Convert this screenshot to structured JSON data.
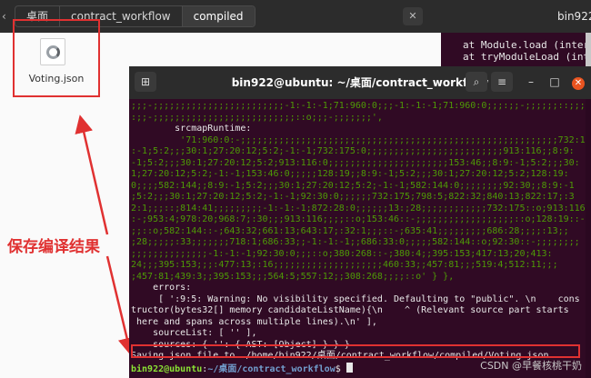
{
  "file_manager": {
    "breadcrumbs": [
      "桌面",
      "contract_workflow",
      "compiled"
    ],
    "file_name": "Voting.json"
  },
  "annotation_text": "保存编译结果",
  "terminal2": {
    "title": "bin922@",
    "lines": [
      "at Module.load (interna",
      "at tryModuleLoad (inte"
    ]
  },
  "terminal": {
    "title": "bin922@ubuntu: ~/桌面/contract_workflow",
    "lines": [
      {
        "style": "gr",
        "text": ";;;-;;;;;;;;;;;;;;;;;;;;;;;;-1:-1:-1;71:960:0;;;-1:-1:-1;71:960:0;;;:;;-;;;;;;::;;;;;;;"
      },
      {
        "style": "gr",
        "text": ":;;-;;;;;;;;;;;;;;;;;;;;;;;;;;::o;;;-;;;;;;;',"
      },
      {
        "style": "wh",
        "text": "        srcmapRuntime:"
      },
      {
        "style": "gr",
        "text": "         '71:960:0:-;;;;;;;;;;;;;;;;;;;;;;;;;;;;;;;;;;;;;;;;;;;;;;;;;;;;;;;;;;732:175;;8:9"
      },
      {
        "style": "gr",
        "text": ":-1;5:2;;;30:1;27:20:12;5:2;-1:-1;732:175:0;;;;;;;;;;;;;;;;;;;;;;;;;913:116;;8:9:"
      },
      {
        "style": "gr",
        "text": "-1;5:2;;;30:1;27:20:12;5:2;913:116:0;;;;;;;;;;;;;;;;;;;;;;153:46;;8:9:-1;5:2;;;30:"
      },
      {
        "style": "gr",
        "text": "1;27:20:12;5:2;-1:-1;153:46:0;;;;;128:19;;8:9:-1;5:2;;;30:1;27:20:12;5:2;128:19:"
      },
      {
        "style": "gr",
        "text": "0;;;;582:144;;8:9:-1;5:2;;;30:1;27:20:12;5:2;-1:-1;582:144:0;;;;;;;;92:30;;8:9:-1"
      },
      {
        "style": "gr",
        "text": ";5:2;;;30:1;27:20:12;5:2;-1:-1;92:30:0;;;;;;732:175;798:5;822:32;840:13;822:17;:3"
      },
      {
        "style": "gr",
        "text": "2:1;;;::;814:41;;;;;;;;;-1:-1:-1;872:28:0;;;;;;13:;28;;;;;;;;;;;;732:175::o;913:116"
      },
      {
        "style": "gr",
        "text": ":-;953:4;978:20;968:7;:30;;;913:116;;;;::o;153:46::-;;;;;;;;;;;;;;;;;;::o;128:19::-;"
      },
      {
        "style": "gr",
        "text": ";;::o;582:144::-;643:32;661:13;643:17;:32:1;;;::-;635:41;;;;;;;;;686:28;;;;:13;;"
      },
      {
        "style": "gr",
        "text": ";28;;;;;:33;;;;;;;718:1;686:33;;-1:-1:-1;;686:33:0;;;;;582:144::o;92:30::-;;;;;;;;"
      },
      {
        "style": "gr",
        "text": ";;;;;;;;;;;;;;-1:-1:-1;92:30:0;;;::o;380:268::-;380:4;;395:153;417:13;20;413:"
      },
      {
        "style": "gr",
        "text": "24;;;395:153;;;:477:13;:16;;;;;;;;;;;;;;;;;;;;460:33;;457:81;;;519:4;512:11;;;"
      },
      {
        "style": "gr",
        "text": ";457:81;439:3;;395:153;;;564:5;557:12;;308:268;;;;::o' } },"
      },
      {
        "style": "wh",
        "text": "    errors:"
      },
      {
        "style": "wh",
        "text": "     [ ':9:5: Warning: No visibility specified. Defaulting to \"public\". \\n    cons"
      },
      {
        "style": "wh",
        "text": "tructor(bytes32[] memory candidateListName){\\n    ^ (Relevant source part starts"
      },
      {
        "style": "wh",
        "text": " here and spans across multiple lines).\\n' ],"
      },
      {
        "style": "wh",
        "text": "    sourceList: [ '' ],"
      },
      {
        "style": "wh",
        "text": "    sources: { '': { AST: [Object] } } }"
      },
      {
        "style": "wh",
        "text": "Saving json file to  /home/bin922/桌面/contract_workflow/compiled/Voting.json"
      }
    ],
    "prompt_user": "bin922@ubuntu",
    "prompt_path": "~/桌面/contract_workflow",
    "prompt_symbol": "$"
  },
  "watermark": "CSDN @早餐核桃干奶"
}
